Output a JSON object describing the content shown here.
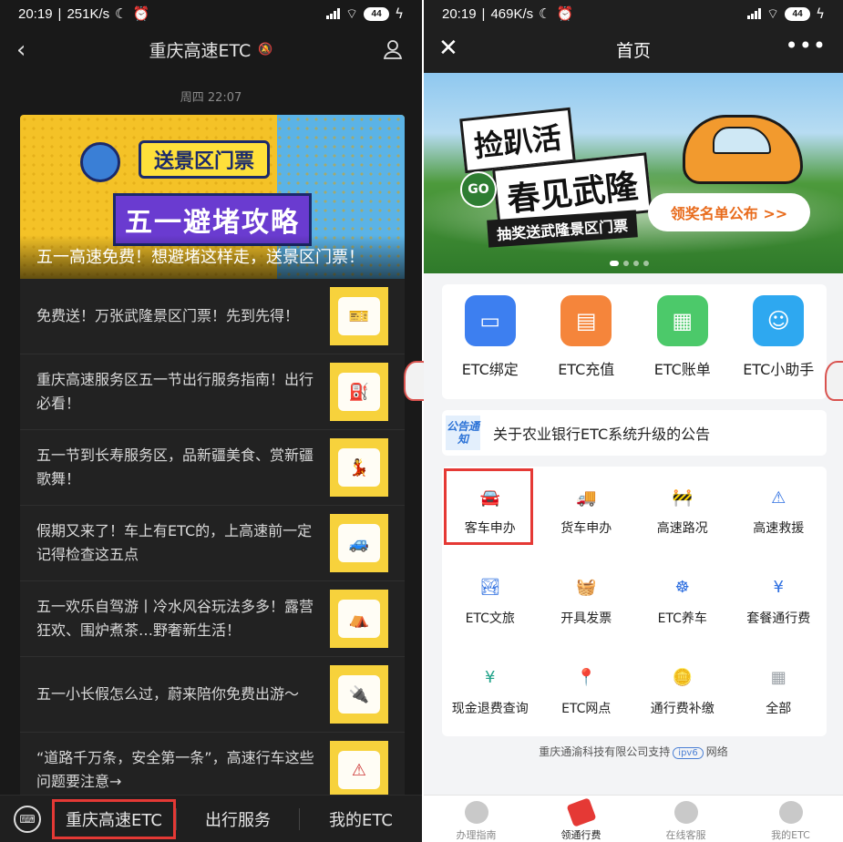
{
  "left": {
    "status": {
      "time": "20:19",
      "speed": "251K/s",
      "battery": "44"
    },
    "nav": {
      "title": "重庆高速ETC",
      "back_icon": "‹",
      "mute_icon": "🔕"
    },
    "timestamp": "周四 22:07",
    "hero": {
      "tag1": "送景区门票",
      "tag2": "五一避堵攻略",
      "caption": "五一高速免费！想避堵这样走，送景区门票！"
    },
    "articles": [
      {
        "title": "免费送！万张武隆景区门票！先到先得！"
      },
      {
        "title": "重庆高速服务区五一节出行服务指南！出行必看！"
      },
      {
        "title": "五一节到长寿服务区，品新疆美食、赏新疆歌舞！"
      },
      {
        "title": "假期又来了！车上有ETC的，上高速前一定记得检查这五点"
      },
      {
        "title": "五一欢乐自驾游丨冷水风谷玩法多多！露营狂欢、围炉煮茶…野奢新生活！"
      },
      {
        "title": "五一小长假怎么过，蔚来陪你免费出游～"
      },
      {
        "title": "“道路千万条，安全第一条”，高速行车这些问题要注意→"
      }
    ],
    "tabs": {
      "t1": "重庆高速ETC",
      "t2": "出行服务",
      "t3": "我的ETC"
    }
  },
  "right": {
    "status": {
      "time": "20:19",
      "speed": "469K/s",
      "battery": "44"
    },
    "nav": {
      "title": "首页",
      "close_icon": "✕",
      "more_icon": "•••"
    },
    "banner": {
      "line1": "捡趴活",
      "go": "GO",
      "line2": "春见武隆",
      "sub": "抽奖送武隆景区门票",
      "button": "领奖名单公布 >>"
    },
    "quick": [
      {
        "label": "ETC绑定",
        "color": "#3d7ff0",
        "icon": "card-link-icon"
      },
      {
        "label": "ETC充值",
        "color": "#f5853b",
        "icon": "card-recharge-icon"
      },
      {
        "label": "ETC账单",
        "color": "#4cc96a",
        "icon": "calendar-bill-icon"
      },
      {
        "label": "ETC小助手",
        "color": "#2ea8f0",
        "icon": "headset-assistant-icon"
      }
    ],
    "notice": {
      "badge": "公告通知",
      "text": "关于农业银行ETC系统升级的公告"
    },
    "services": [
      {
        "label": "客车申办",
        "color": "#2e6fe0",
        "glyph": "🚘"
      },
      {
        "label": "货车申办",
        "color": "#f08a1c",
        "glyph": "🚚"
      },
      {
        "label": "高速路况",
        "color": "#e04a2e",
        "glyph": "🚧"
      },
      {
        "label": "高速救援",
        "color": "#2e6fe0",
        "glyph": "⚠"
      },
      {
        "label": "ETC文旅",
        "color": "#2e6fe0",
        "glyph": "🏞"
      },
      {
        "label": "开具发票",
        "color": "#f08a1c",
        "glyph": "🧺"
      },
      {
        "label": "ETC养车",
        "color": "#2e6fe0",
        "glyph": "☸"
      },
      {
        "label": "套餐通行费",
        "color": "#2e6fe0",
        "glyph": "¥"
      },
      {
        "label": "现金退费查询",
        "color": "#22a38a",
        "glyph": "¥"
      },
      {
        "label": "ETC网点",
        "color": "#2e6fe0",
        "glyph": "📍"
      },
      {
        "label": "通行费补缴",
        "color": "#2e6fe0",
        "glyph": "🪙"
      },
      {
        "label": "全部",
        "color": "#9aa0a6",
        "glyph": "▦"
      }
    ],
    "footnote": {
      "pre": "重庆通渝科技有限公司支持",
      "badge": "ipv6",
      "post": "网络"
    },
    "tabs": [
      "办理指南",
      "领通行费",
      "在线客服",
      "我的ETC"
    ]
  }
}
